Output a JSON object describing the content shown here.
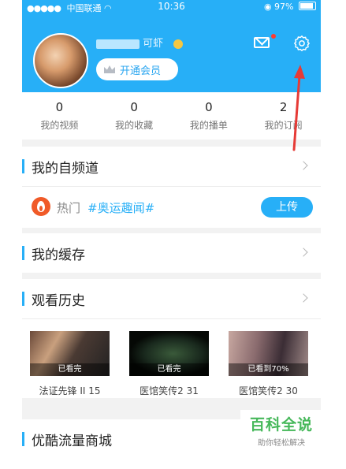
{
  "status_bar": {
    "carrier": "中国联通",
    "time": "10:36",
    "battery": "97%"
  },
  "colors": {
    "accent": "#27aff7",
    "watermark_green": "#46b85a",
    "annotation_red": "#e63a36"
  },
  "profile": {
    "username": "可虾",
    "vip_button": "开通会员"
  },
  "header_icons": {
    "mail": "mail-icon",
    "settings": "gear-icon"
  },
  "stats": [
    {
      "value": "0",
      "label": "我的视频"
    },
    {
      "value": "0",
      "label": "我的收藏"
    },
    {
      "value": "0",
      "label": "我的播单"
    },
    {
      "value": "2",
      "label": "我的订阅"
    }
  ],
  "channel": {
    "title": "我的自频道",
    "hot_label": "热门",
    "hot_tag": "#奥运趣闻#",
    "upload_label": "上传"
  },
  "cache": {
    "title": "我的缓存"
  },
  "history": {
    "title": "观看历史",
    "items": [
      {
        "status": "已看完",
        "caption": "法证先锋 II  15"
      },
      {
        "status": "已看完",
        "caption": "医馆笑传2 31"
      },
      {
        "status": "已看到70%",
        "caption": "医馆笑传2 30"
      }
    ]
  },
  "traffic_shop": {
    "title": "优酷流量商城"
  },
  "watermark": {
    "title": "百科全说",
    "subtitle": "助你轻松解决"
  }
}
